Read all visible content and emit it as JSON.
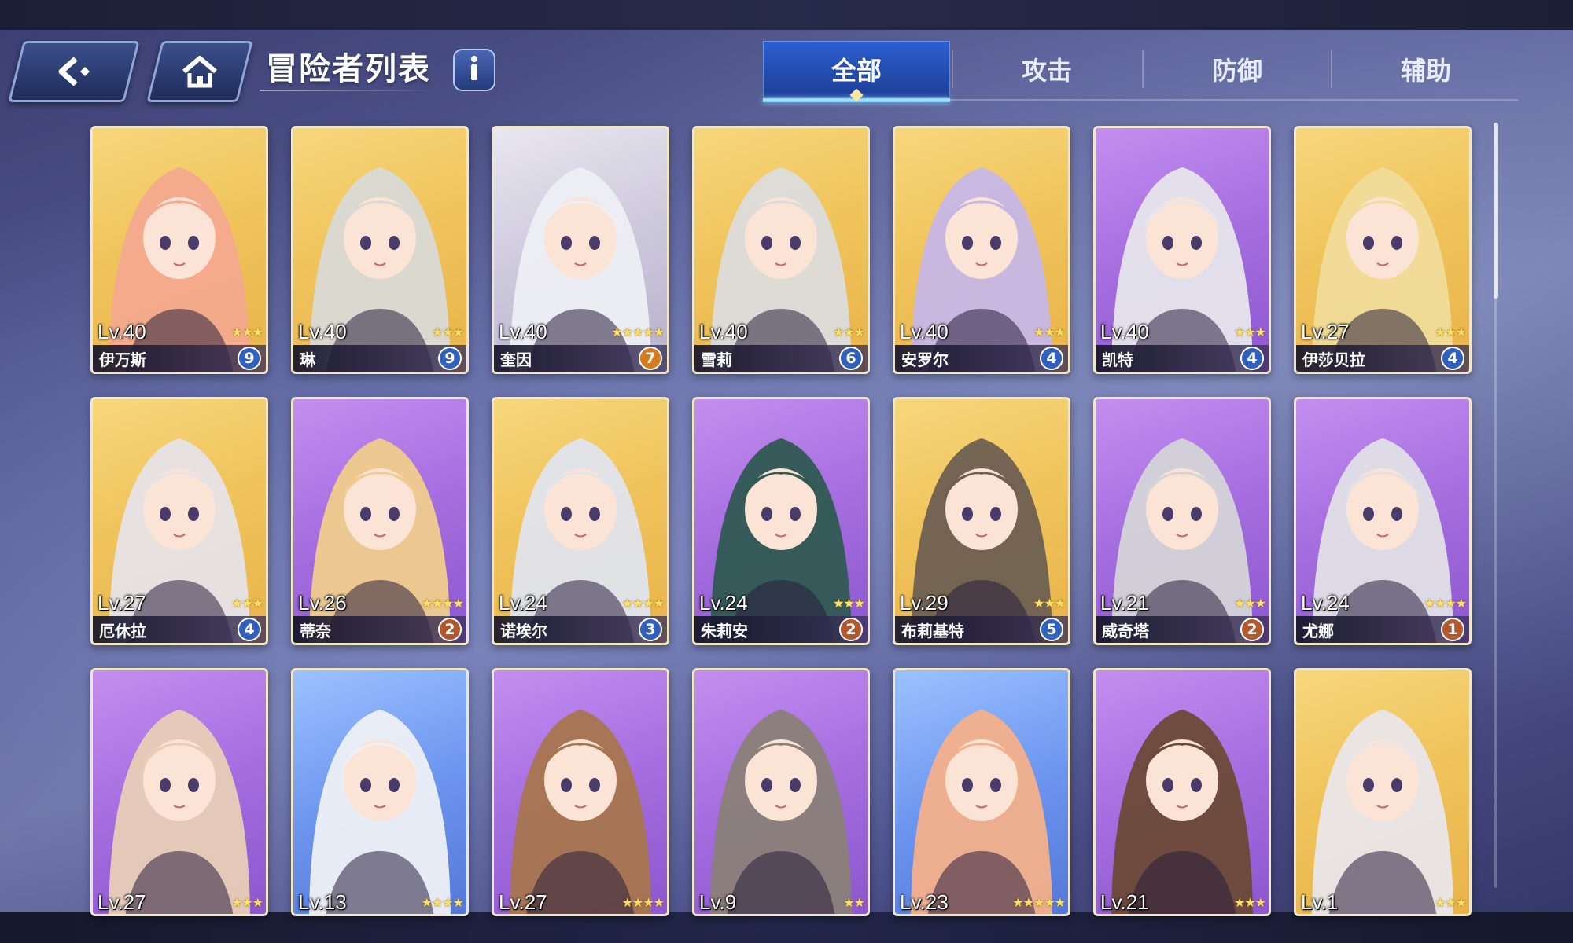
{
  "header": {
    "title": "冒险者列表",
    "back_icon": "back-arrow-icon",
    "home_icon": "home-icon",
    "info_icon": "info-icon"
  },
  "tabs": [
    {
      "label": "全部",
      "active": true
    },
    {
      "label": "攻击",
      "active": false
    },
    {
      "label": "防御",
      "active": false
    },
    {
      "label": "辅助",
      "active": false
    }
  ],
  "colors": {
    "accent": "#2c5fd0",
    "tab_underline": "#7ed6ff",
    "star": "#ffe066",
    "gold_card": "#f0c45c",
    "purple_card": "#a56ddf",
    "blue_card": "#6e97f0"
  },
  "adventurers": [
    {
      "level": "Lv.40",
      "stars": "★★★",
      "name": "伊万斯",
      "badge": "9",
      "frame": "gold",
      "hair": "#f3a98e",
      "badge_style": "blue"
    },
    {
      "level": "Lv.40",
      "stars": "★★★",
      "name": "琳",
      "badge": "9",
      "frame": "gold",
      "hair": "#d9d9d6",
      "badge_style": "blue"
    },
    {
      "level": "Lv.40",
      "stars": "★★★★★",
      "name": "奎因",
      "badge": "7",
      "frame": "silver",
      "hair": "#eeeef4",
      "badge_style": "orange"
    },
    {
      "level": "Lv.40",
      "stars": "★★★",
      "name": "雪莉",
      "badge": "6",
      "frame": "gold",
      "hair": "#dcdcdc",
      "badge_style": "blue"
    },
    {
      "level": "Lv.40",
      "stars": "★★★",
      "name": "安罗尔",
      "badge": "4",
      "frame": "gold",
      "hair": "#c6b6e6",
      "badge_style": "blue"
    },
    {
      "level": "Lv.40",
      "stars": "★★★",
      "name": "凯特",
      "badge": "4",
      "frame": "purple",
      "hair": "#e6e6ec",
      "badge_style": "blue"
    },
    {
      "level": "Lv.27",
      "stars": "★★★",
      "name": "伊莎贝拉",
      "badge": "4",
      "frame": "gold",
      "hair": "#f0dc9a",
      "badge_style": "blue"
    },
    {
      "level": "Lv.27",
      "stars": "★★★",
      "name": "厄休拉",
      "badge": "4",
      "frame": "gold",
      "hair": "#e6e3e8",
      "badge_style": "blue"
    },
    {
      "level": "Lv.26",
      "stars": "★★★★",
      "name": "蒂奈",
      "badge": "2",
      "frame": "purple",
      "hair": "#f0cc8c",
      "badge_style": "bronze"
    },
    {
      "level": "Lv.24",
      "stars": "★★★★",
      "name": "诺埃尔",
      "badge": "3",
      "frame": "gold",
      "hair": "#e0e4ee",
      "badge_style": "blue"
    },
    {
      "level": "Lv.24",
      "stars": "★★★",
      "name": "朱莉安",
      "badge": "2",
      "frame": "purple",
      "hair": "#2f5a52",
      "badge_style": "bronze"
    },
    {
      "level": "Lv.29",
      "stars": "★★★",
      "name": "布莉基特",
      "badge": "5",
      "frame": "gold",
      "hair": "#6e5f52",
      "badge_style": "blue"
    },
    {
      "level": "Lv.21",
      "stars": "★★★",
      "name": "威奇塔",
      "badge": "2",
      "frame": "purple",
      "hair": "#d4d4d8",
      "badge_style": "bronze"
    },
    {
      "level": "Lv.24",
      "stars": "★★★★",
      "name": "尤娜",
      "badge": "1",
      "frame": "purple",
      "hair": "#e0e0e6",
      "badge_style": "bronze"
    },
    {
      "level": "Lv.27",
      "stars": "★★★",
      "frame": "purple",
      "hair": "#e8cdb6"
    },
    {
      "level": "Lv.13",
      "stars": "★★★★",
      "frame": "blue",
      "hair": "#eef0f6"
    },
    {
      "level": "Lv.27",
      "stars": "★★★★",
      "frame": "purple",
      "hair": "#a8764e"
    },
    {
      "level": "Lv.9",
      "stars": "★★",
      "frame": "purple",
      "hair": "#8a8078"
    },
    {
      "level": "Lv.23",
      "stars": "★★★★★",
      "frame": "blue",
      "hair": "#f4b08a"
    },
    {
      "level": "Lv.21",
      "stars": "★★★",
      "frame": "purple",
      "hair": "#6b4a36"
    },
    {
      "level": "Lv.1",
      "stars": "★★★",
      "frame": "gold",
      "hair": "#e9e6ea"
    }
  ]
}
